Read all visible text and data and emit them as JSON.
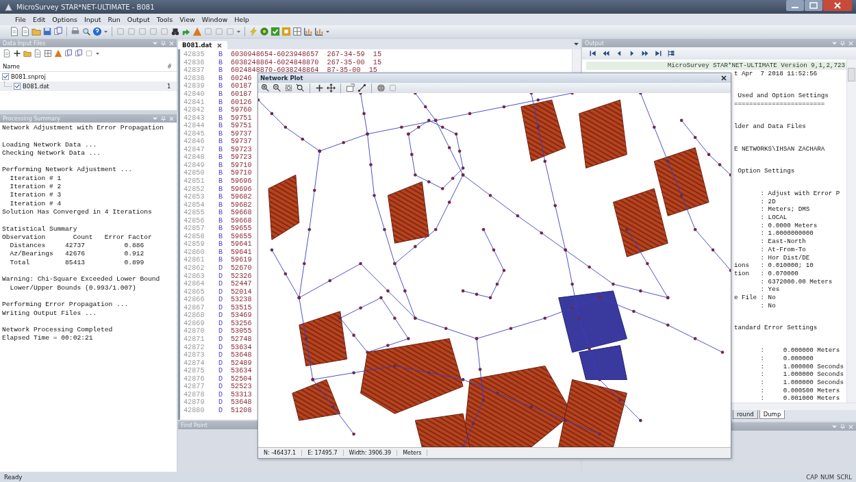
{
  "window": {
    "title": "MicroSurvey STAR*NET-ULTIMATE - B081"
  },
  "menu": [
    "File",
    "Edit",
    "Options",
    "Input",
    "Run",
    "Output",
    "Tools",
    "View",
    "Window",
    "Help"
  ],
  "data_input_files": {
    "title": "Data Input Files",
    "columns": [
      "Name",
      "#"
    ],
    "items": [
      {
        "name": "B081.snproj",
        "checked": true,
        "selected": false,
        "children": [
          {
            "name": "B081.dat",
            "count": "1",
            "checked": true,
            "selected": true
          }
        ]
      }
    ]
  },
  "processing_summary": {
    "title": "Processing Summary",
    "paragraphs": [
      [
        "Network Adjustment with Error Propagation"
      ],
      [
        "Loading Network Data ...",
        "Checking Network Data ..."
      ],
      [
        "Performing Network Adjustment ...",
        "  Iteration # 1",
        "  Iteration # 2",
        "  Iteration # 3",
        "  Iteration # 4",
        "Solution Has Converged in 4 Iterations"
      ],
      [
        "Statistical Summary",
        "Observation       Count   Error Factor",
        "  Distances     42737          0.886",
        "  Az/Bearings   42676          0.912",
        "  Total         85413          0.899"
      ],
      [
        "Warning: Chi-Square Exceeded Lower Bound",
        "  Lower/Upper Bounds (0.993/1.007)"
      ],
      [
        "Performing Error Propagation ...",
        "Writing Output Files ..."
      ],
      [
        "Network Processing Completed",
        "Elapsed Time = 00:02:21"
      ]
    ]
  },
  "editor": {
    "tabs": [
      {
        "label": "B081.dat",
        "selected": true
      }
    ],
    "lines": [
      {
        "number": "42835",
        "code": "B",
        "text": "6030948654-6023948657  267-34-59  15"
      },
      {
        "number": "42836",
        "code": "B",
        "text": "6038248864-6024848870  267-35-00  15"
      },
      {
        "number": "42837",
        "code": "B",
        "text": "6024848870-6038248864  87-35-00  15"
      },
      {
        "number": "42838",
        "code": "B",
        "text": "60246"
      },
      {
        "number": "42839",
        "code": "B",
        "text": "60187"
      },
      {
        "number": "42840",
        "code": "B",
        "text": "60187"
      },
      {
        "number": "42841",
        "code": "B",
        "text": "60126"
      },
      {
        "number": "42842",
        "code": "B",
        "text": "59760"
      },
      {
        "number": "42843",
        "code": "B",
        "text": "59751"
      },
      {
        "number": "42844",
        "code": "B",
        "text": "59751"
      },
      {
        "number": "42845",
        "code": "B",
        "text": "59737"
      },
      {
        "number": "42846",
        "code": "B",
        "text": "59737"
      },
      {
        "number": "42847",
        "code": "B",
        "text": "59723"
      },
      {
        "number": "42848",
        "code": "B",
        "text": "59723"
      },
      {
        "number": "42849",
        "code": "B",
        "text": "59710"
      },
      {
        "number": "42850",
        "code": "B",
        "text": "59710"
      },
      {
        "number": "42851",
        "code": "B",
        "text": "59696"
      },
      {
        "number": "42852",
        "code": "B",
        "text": "59696"
      },
      {
        "number": "42853",
        "code": "B",
        "text": "59682"
      },
      {
        "number": "42854",
        "code": "B",
        "text": "59682"
      },
      {
        "number": "42855",
        "code": "B",
        "text": "59668"
      },
      {
        "number": "42856",
        "code": "B",
        "text": "59668"
      },
      {
        "number": "42857",
        "code": "B",
        "text": "59655"
      },
      {
        "number": "42858",
        "code": "B",
        "text": "59655"
      },
      {
        "number": "42859",
        "code": "B",
        "text": "59641"
      },
      {
        "number": "42860",
        "code": "B",
        "text": "59641"
      },
      {
        "number": "42861",
        "code": "B",
        "text": "59619"
      },
      {
        "number": "42862",
        "code": "D",
        "text": "52670"
      },
      {
        "number": "42863",
        "code": "D",
        "text": "52326"
      },
      {
        "number": "42864",
        "code": "D",
        "text": "52447"
      },
      {
        "number": "42865",
        "code": "D",
        "text": "52014"
      },
      {
        "number": "42866",
        "code": "D",
        "text": "53238"
      },
      {
        "number": "42867",
        "code": "D",
        "text": "53515"
      },
      {
        "number": "42868",
        "code": "D",
        "text": "53469"
      },
      {
        "number": "42869",
        "code": "D",
        "text": "53256"
      },
      {
        "number": "42870",
        "code": "D",
        "text": "53055"
      },
      {
        "number": "42871",
        "code": "D",
        "text": "52748"
      },
      {
        "number": "42872",
        "code": "D",
        "text": "53634"
      },
      {
        "number": "42873",
        "code": "D",
        "text": "53648"
      },
      {
        "number": "42874",
        "code": "D",
        "text": "52489"
      },
      {
        "number": "42875",
        "code": "D",
        "text": "53634"
      },
      {
        "number": "42876",
        "code": "D",
        "text": "52504"
      },
      {
        "number": "42877",
        "code": "D",
        "text": "52523"
      },
      {
        "number": "42878",
        "code": "D",
        "text": "53313"
      },
      {
        "number": "42879",
        "code": "D",
        "text": "53648"
      },
      {
        "number": "42880",
        "code": "D",
        "text": "51208"
      }
    ]
  },
  "find_point": {
    "title": "Find Point"
  },
  "output": {
    "title": "Output",
    "header_line": "MicroSurvey STAR*NET-ULTIMATE Version 9,1,2,723",
    "groups": [
      [
        "t Apr  7 2018 11:52:56"
      ],
      [
        " Used and Option Settings",
        "========================"
      ],
      [
        "lder and Data Files"
      ],
      [
        "E NETWORKS\\IHSAN ZACHARA"
      ],
      [
        " Option Settings"
      ],
      [
        "       : Adjust with Error P",
        "       : 2D",
        "       : Meters; DMS",
        "       : LOCAL",
        "       : 0.0000 Meters",
        "       : 1.0000000000",
        "       : East-North",
        "       : At-From-To",
        "       : Hor Dist/DE",
        "ions   : 0.010000; 10",
        "tion   : 0.070000",
        "       : 6372000.00 Meters",
        "       : Yes",
        "e File : No",
        "       : No"
      ],
      [
        "tandard Error Settings"
      ],
      [
        "       :     0.000000 Meters",
        "       :     0.000000",
        "       :     1.000000 Seconds",
        "       :     1.000000 Seconds",
        "       :     1.000000 Seconds",
        "       :     0.000500 Meters",
        "       :     0.001000 Meters"
      ]
    ],
    "tabs": [
      {
        "label": "round",
        "selected": false
      },
      {
        "label": "Dump",
        "selected": true
      }
    ]
  },
  "network_plot": {
    "title": "Network Plot",
    "status": [
      "N: -46437.1",
      "E: 17495.7",
      "Width: 3906.39",
      "Meters"
    ]
  },
  "status_bar": {
    "text": "Ready",
    "indicators": [
      "CAP",
      "NUM",
      "SCRL"
    ]
  }
}
